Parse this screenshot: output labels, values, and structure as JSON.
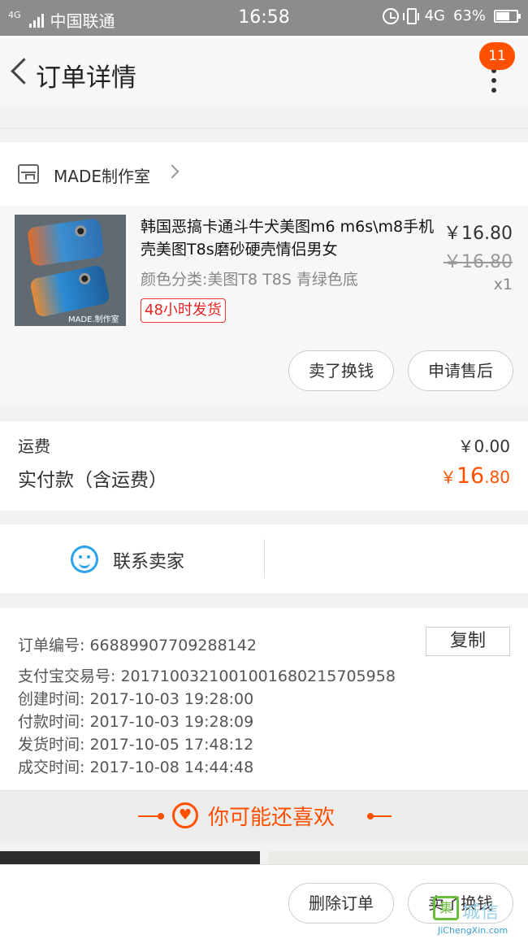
{
  "status_bar": {
    "carrier": "中国联通",
    "network_small": "4G",
    "time": "16:58",
    "network": "4G",
    "battery": "63%"
  },
  "nav": {
    "title": "订单详情",
    "badge_count": "11"
  },
  "shop": {
    "name": "MADE制作室"
  },
  "product": {
    "title": "韩国恶搞卡通斗牛犬美图m6 m6s\\m8手机壳美图T8s磨砂硬壳情侣男女",
    "sku": "颜色分类:美图T8  T8S 青绿色底",
    "tag": "48小时发货",
    "price": "￥16.80",
    "original_price": "￥16.80",
    "quantity": "x1",
    "image_watermark": "MADE.制作室",
    "buttons": {
      "sell": "卖了换钱",
      "after_sale": "申请售后"
    }
  },
  "fees": {
    "shipping_label": "运费",
    "shipping_value": "￥0.00",
    "paid_label": "实付款（含运费）",
    "paid_currency": "￥",
    "paid_int": "16",
    "paid_dec": ".80"
  },
  "contact": {
    "label": "联系卖家"
  },
  "order_info": {
    "order_no": "订单编号:   66889907709288142",
    "copy_label": "复制",
    "alipay_no": "支付宝交易号:   2017100321001001680215705958",
    "created": "创建时间:   2017-10-03 19:28:00",
    "paid": "付款时间:   2017-10-03 19:28:09",
    "shipped": "发货时间:   2017-10-05 17:48:12",
    "completed": "成交时间:   2017-10-08 14:44:48"
  },
  "recommend": {
    "label": "你可能还喜欢"
  },
  "bottom_bar": {
    "delete": "删除订单",
    "sell": "卖了换钱"
  },
  "watermark": {
    "cn": "城信",
    "logo_char": "集",
    "en": "JiChengXin.com"
  },
  "colors": {
    "accent": "#ff5000",
    "contact_blue": "#2ba3ea",
    "tag_red": "#e22222"
  }
}
